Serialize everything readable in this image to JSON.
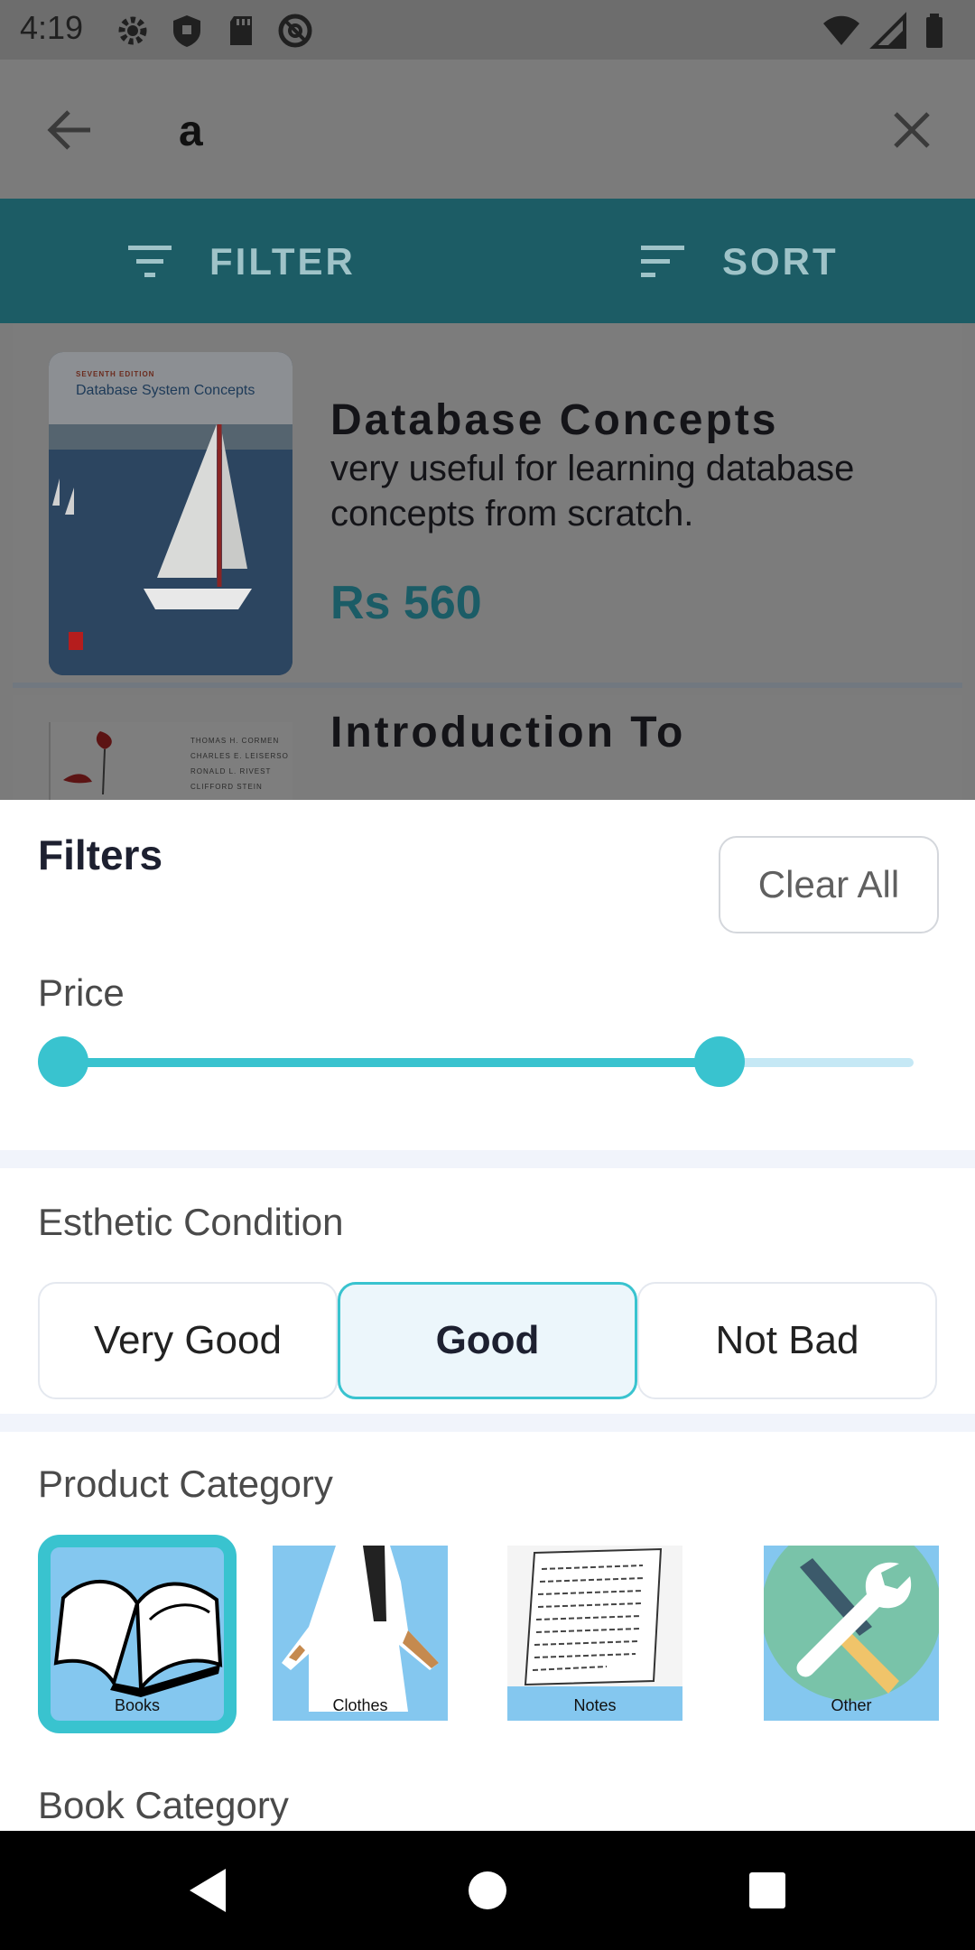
{
  "status_bar": {
    "time": "4:19"
  },
  "search": {
    "query": "a"
  },
  "toolbar": {
    "filter_label": "FILTER",
    "sort_label": "SORT"
  },
  "results": [
    {
      "title": "Database Concepts",
      "description": "very useful for learning database concepts from scratch.",
      "price": "Rs 560",
      "cover": {
        "edition": "SEVENTH EDITION",
        "title": "Database System Concepts"
      }
    },
    {
      "title": "Introduction To",
      "cover": {
        "authors": [
          "THOMAS H. CORMEN",
          "CHARLES E. LEISERSO",
          "RONALD L. RIVEST",
          "CLIFFORD STEIN"
        ]
      }
    }
  ],
  "filters": {
    "title": "Filters",
    "clear_all": "Clear All",
    "price": {
      "label": "Price",
      "range_low_fraction": 0.0,
      "range_high_fraction": 0.79
    },
    "condition": {
      "label": "Esthetic Condition",
      "options": [
        "Very Good",
        "Good",
        "Not Bad"
      ],
      "selected": "Good"
    },
    "category": {
      "label": "Product Category",
      "items": [
        "Books",
        "Clothes",
        "Notes",
        "Other"
      ],
      "selected": "Books"
    },
    "book_category": {
      "label": "Book Category"
    }
  },
  "colors": {
    "accent": "#39c3cf",
    "toolbar": "#1c5c65",
    "tile_bg": "#84c7ef",
    "price": "#1b5c66"
  }
}
